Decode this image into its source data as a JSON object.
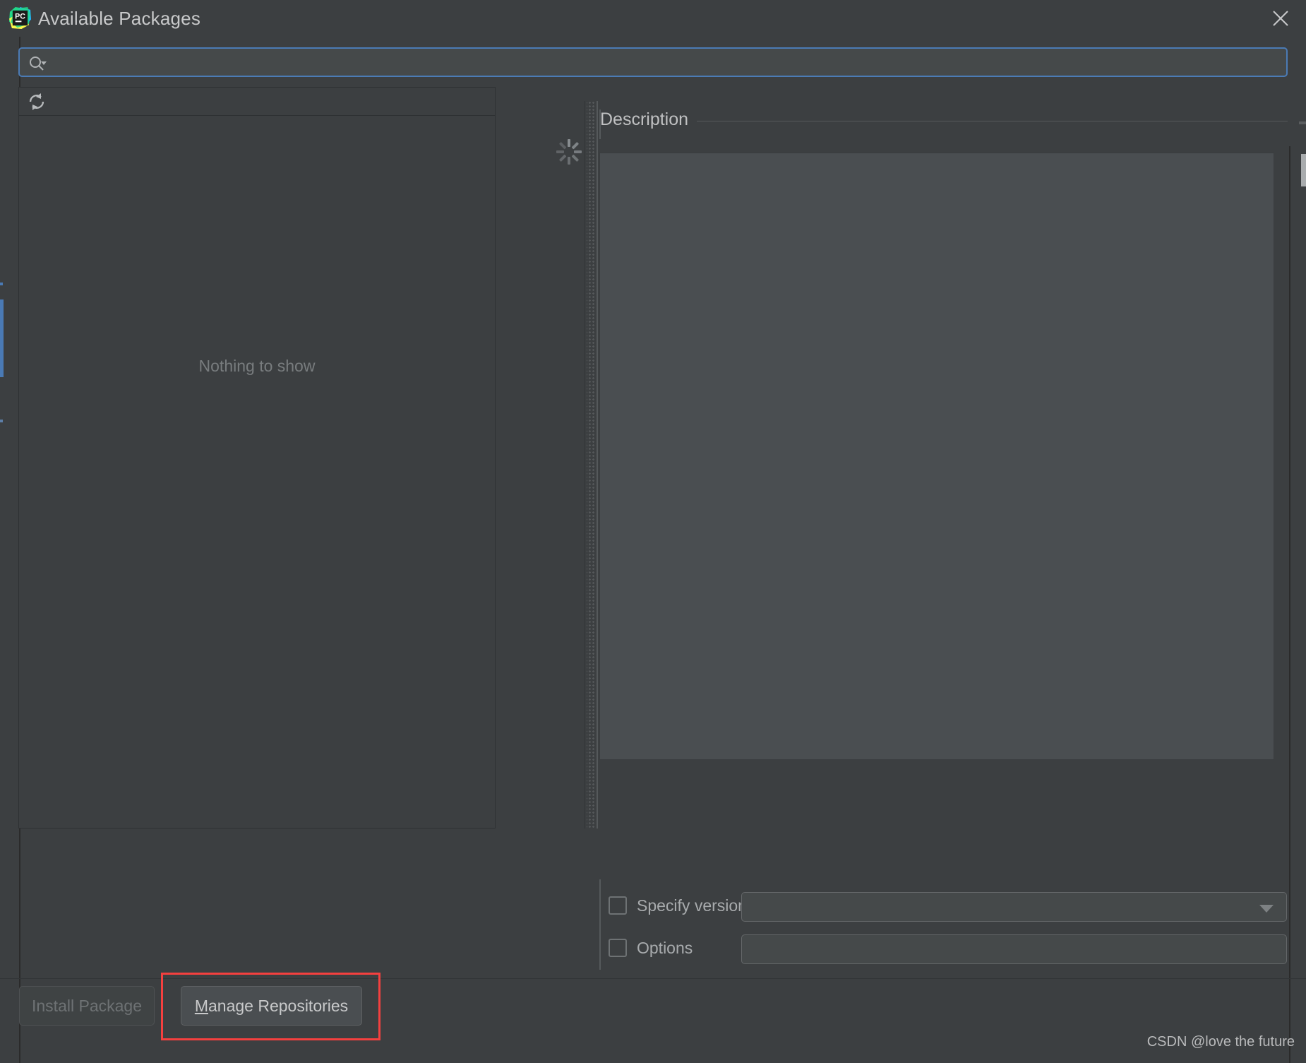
{
  "window": {
    "title": "Available Packages",
    "app_icon": "pycharm-logo-icon",
    "close_icon": "close-icon"
  },
  "search": {
    "icon": "search-icon",
    "value": "",
    "placeholder": ""
  },
  "packages_panel": {
    "refresh_icon": "refresh-icon",
    "empty_message": "Nothing to show",
    "loading_icon": "loading-spinner-icon"
  },
  "description_panel": {
    "title": "Description",
    "content": ""
  },
  "options": {
    "specify_version": {
      "label": "Specify version",
      "checked": false,
      "value": "",
      "dropdown_icon": "chevron-down-icon"
    },
    "options_row": {
      "label": "Options",
      "checked": false,
      "value": ""
    }
  },
  "buttons": {
    "install": {
      "label": "Install Package",
      "enabled": false
    },
    "manage": {
      "mnemonic": "M",
      "label_rest": "anage Repositories",
      "full_label": "Manage Repositories",
      "enabled": true
    }
  },
  "annotation": {
    "highlight_color": "#f4403f",
    "target": "manage-repositories-button"
  },
  "watermark": {
    "text": "CSDN @love the future"
  },
  "colors": {
    "dialog_background": "#3c3f41",
    "panel_background": "#4a4e51",
    "focus_border": "#4b7bb5",
    "text_primary": "#c8c9ca",
    "text_muted": "#787c7e",
    "border": "#55595b"
  }
}
